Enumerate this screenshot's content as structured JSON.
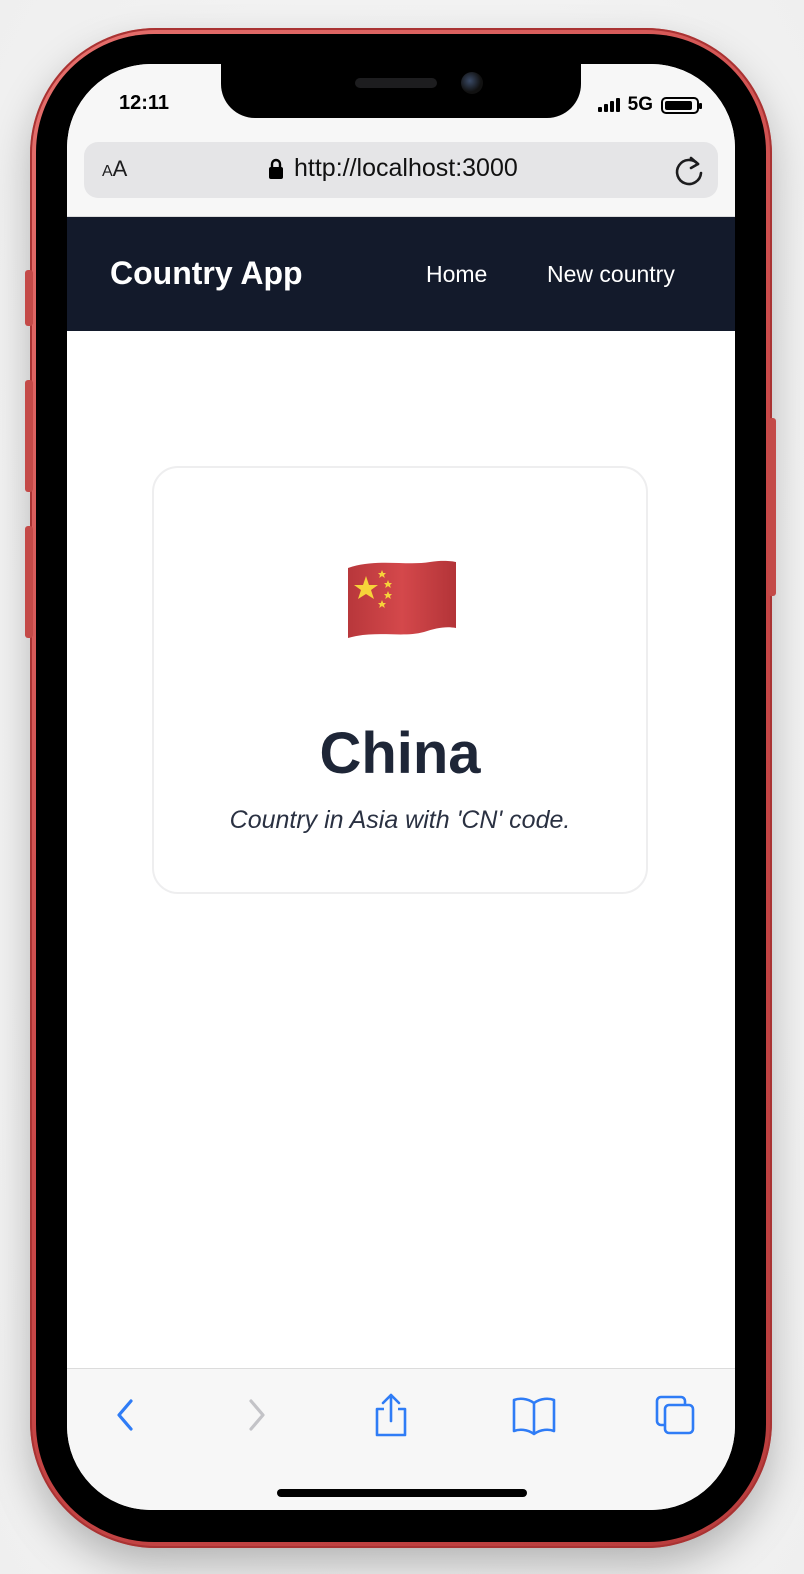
{
  "status_bar": {
    "time": "12:11",
    "network": "5G",
    "battery_level": 0.9
  },
  "browser": {
    "text_size_label_small": "A",
    "text_size_label_large": "A",
    "url": "http://localhost:3000"
  },
  "app_nav": {
    "brand": "Country App",
    "links": [
      {
        "label": "Home"
      },
      {
        "label": "New country"
      }
    ]
  },
  "country_card": {
    "flag_icon": "china-flag-icon",
    "name": "China",
    "description": "Country in Asia with 'CN' code."
  },
  "toolbar": {
    "icons": [
      "back-icon",
      "forward-icon",
      "share-icon",
      "bookmarks-icon",
      "tabs-icon"
    ]
  },
  "colors": {
    "nav_background": "#131a2b",
    "toolbar_accent": "#2f7cf6",
    "phone_frame": "#c94848",
    "text_dark": "#1e2637"
  }
}
